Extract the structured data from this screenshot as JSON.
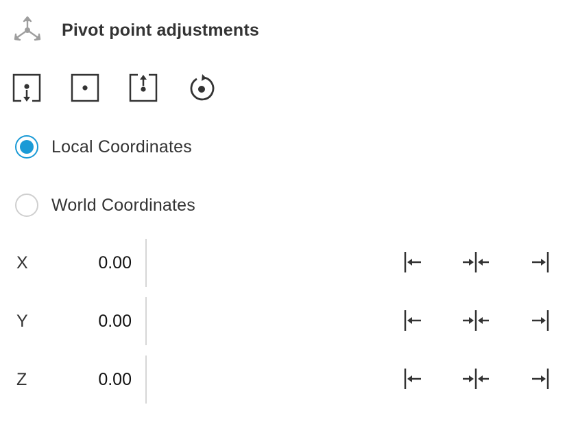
{
  "header": {
    "title": "Pivot point adjustments",
    "icon": "pivot-axes-icon"
  },
  "toolbar": {
    "buttons": [
      {
        "icon": "pivot-to-bottom-icon"
      },
      {
        "icon": "pivot-to-center-icon"
      },
      {
        "icon": "pivot-to-top-icon"
      },
      {
        "icon": "reset-pivot-icon"
      }
    ]
  },
  "coordinates": {
    "local": {
      "label": "Local Coordinates",
      "selected": true
    },
    "world": {
      "label": "World Coordinates",
      "selected": false
    }
  },
  "axes": [
    {
      "label": "X",
      "value": "0.00"
    },
    {
      "label": "Y",
      "value": "0.00"
    },
    {
      "label": "Z",
      "value": "0.00"
    }
  ],
  "align_icons": [
    "align-min-icon",
    "align-center-icon",
    "align-max-icon"
  ],
  "colors": {
    "accent": "#1a9ad6",
    "text": "#333333",
    "icon": "#333333",
    "icon_muted": "#9e9e9e",
    "divider": "#d6d6d6"
  }
}
